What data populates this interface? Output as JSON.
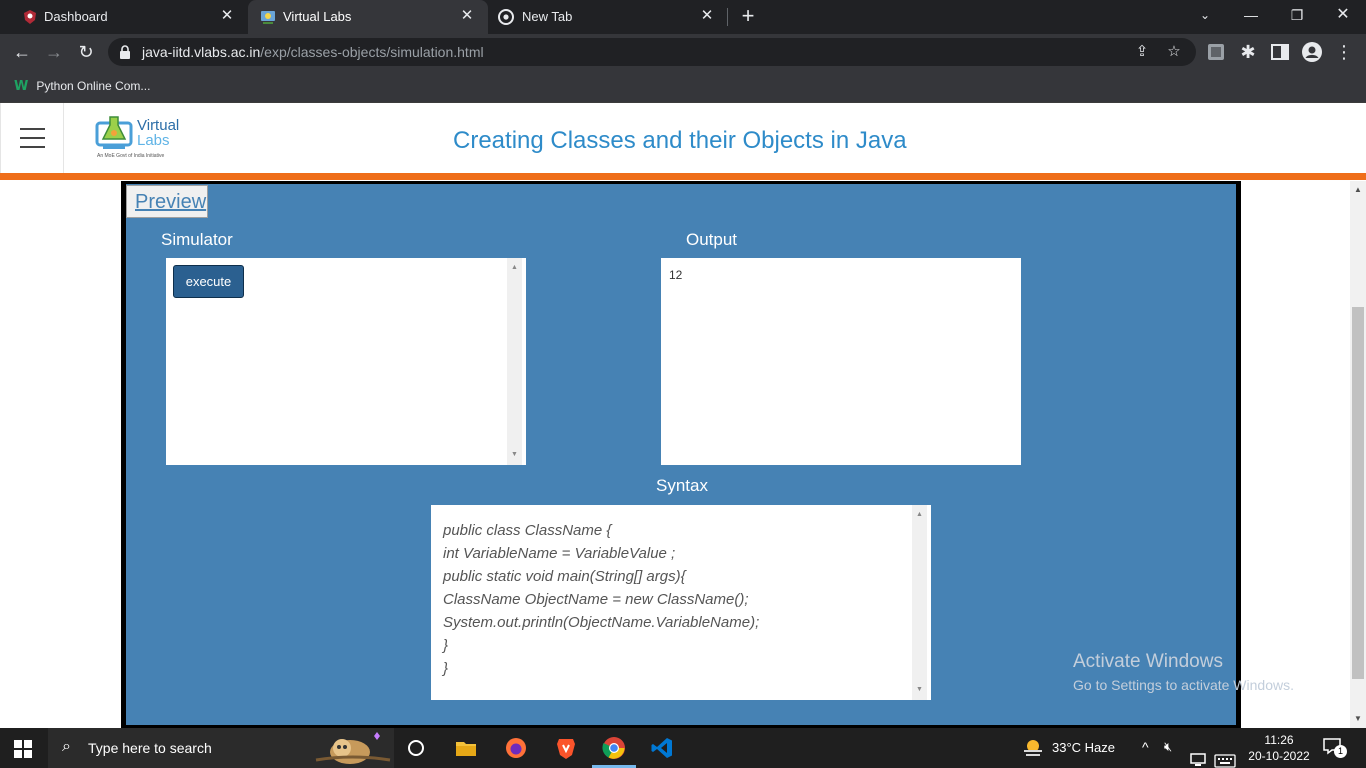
{
  "browser": {
    "tabs": [
      {
        "title": "Dashboard",
        "active": false
      },
      {
        "title": "Virtual Labs",
        "active": true
      },
      {
        "title": "New Tab",
        "active": false
      }
    ],
    "url_host": "java-iitd.vlabs.ac.in",
    "url_path": "/exp/classes-objects/simulation.html",
    "bookmark": "Python Online Com..."
  },
  "site": {
    "logo_line1": "Virtual",
    "logo_line2": "Labs",
    "logo_tagline": "An MoE Govt of India Initiative",
    "title": "Creating Classes and their Objects in Java"
  },
  "simulation": {
    "preview_label": "Preview",
    "simulator_label": "Simulator",
    "output_label": "Output",
    "execute_label": "execute",
    "output_value": "12",
    "syntax_label": "Syntax",
    "syntax_lines": [
      "public class ClassName {",
      "int VariableName = VariableValue ;",
      "public static void main(String[] args){",
      "ClassName ObjectName = new ClassName();",
      "System.out.println(ObjectName.VariableName);",
      "}",
      "}"
    ]
  },
  "watermark": {
    "line1": "Activate Windows",
    "line2": "Go to Settings to activate Windows."
  },
  "taskbar": {
    "search_placeholder": "Type here to search",
    "weather": "33°C  Haze",
    "time": "11:26",
    "date": "20-10-2022",
    "notification_count": "1"
  },
  "colors": {
    "sim_background": "#4682b4",
    "header_accent": "#ef6e1a",
    "title_blue": "#2e8bc9"
  }
}
